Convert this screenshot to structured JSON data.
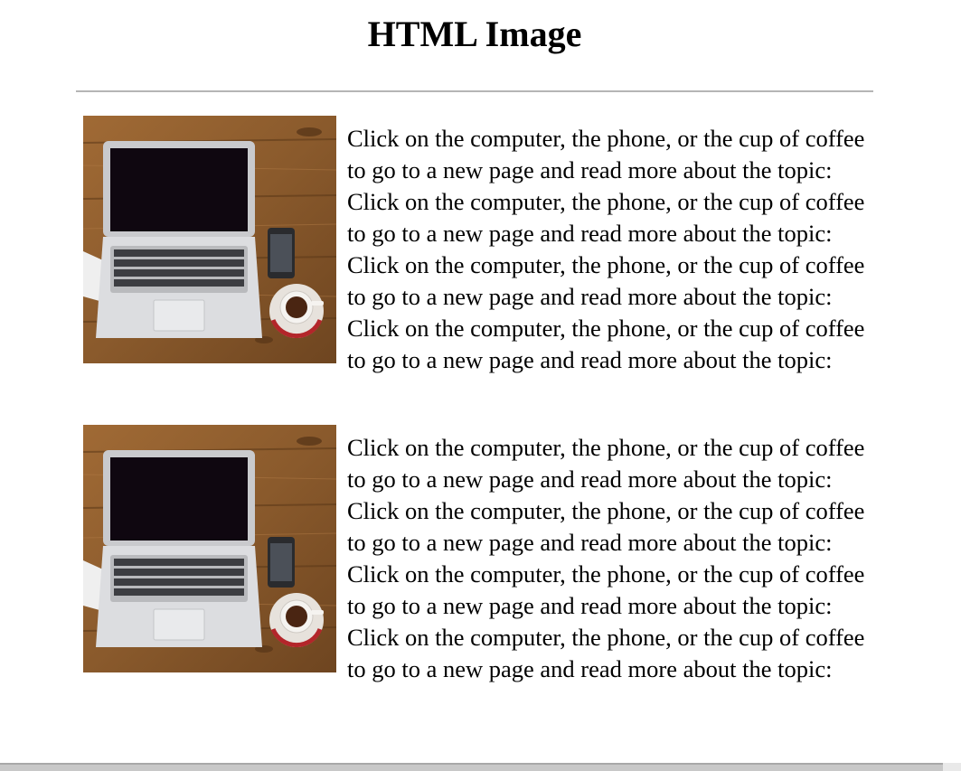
{
  "page": {
    "title": "HTML Image"
  },
  "articles": [
    {
      "image_alt": "Laptop, phone and cup of coffee on a wooden desk",
      "text": "Click on the computer, the phone, or the cup of coffee to go to a new page and read more about the topic: Click on the computer, the phone, or the cup of coffee to go to a new page and read more about the topic: Click on the computer, the phone, or the cup of coffee to go to a new page and read more about the topic: Click on the computer, the phone, or the cup of coffee to go to a new page and read more about the topic:"
    },
    {
      "image_alt": "Laptop, phone and cup of coffee on a wooden desk",
      "text": "Click on the computer, the phone, or the cup of coffee to go to a new page and read more about the topic: Click on the computer, the phone, or the cup of coffee to go to a new page and read more about the topic: Click on the computer, the phone, or the cup of coffee to go to a new page and read more about the topic: Click on the computer, the phone, or the cup of coffee to go to a new page and read more about the topic:"
    }
  ],
  "colors": {
    "desk_wood": "#8a5a2c",
    "laptop_body": "#d9dadc",
    "screen": "#0f0710",
    "divider": "#b5b5b5"
  }
}
